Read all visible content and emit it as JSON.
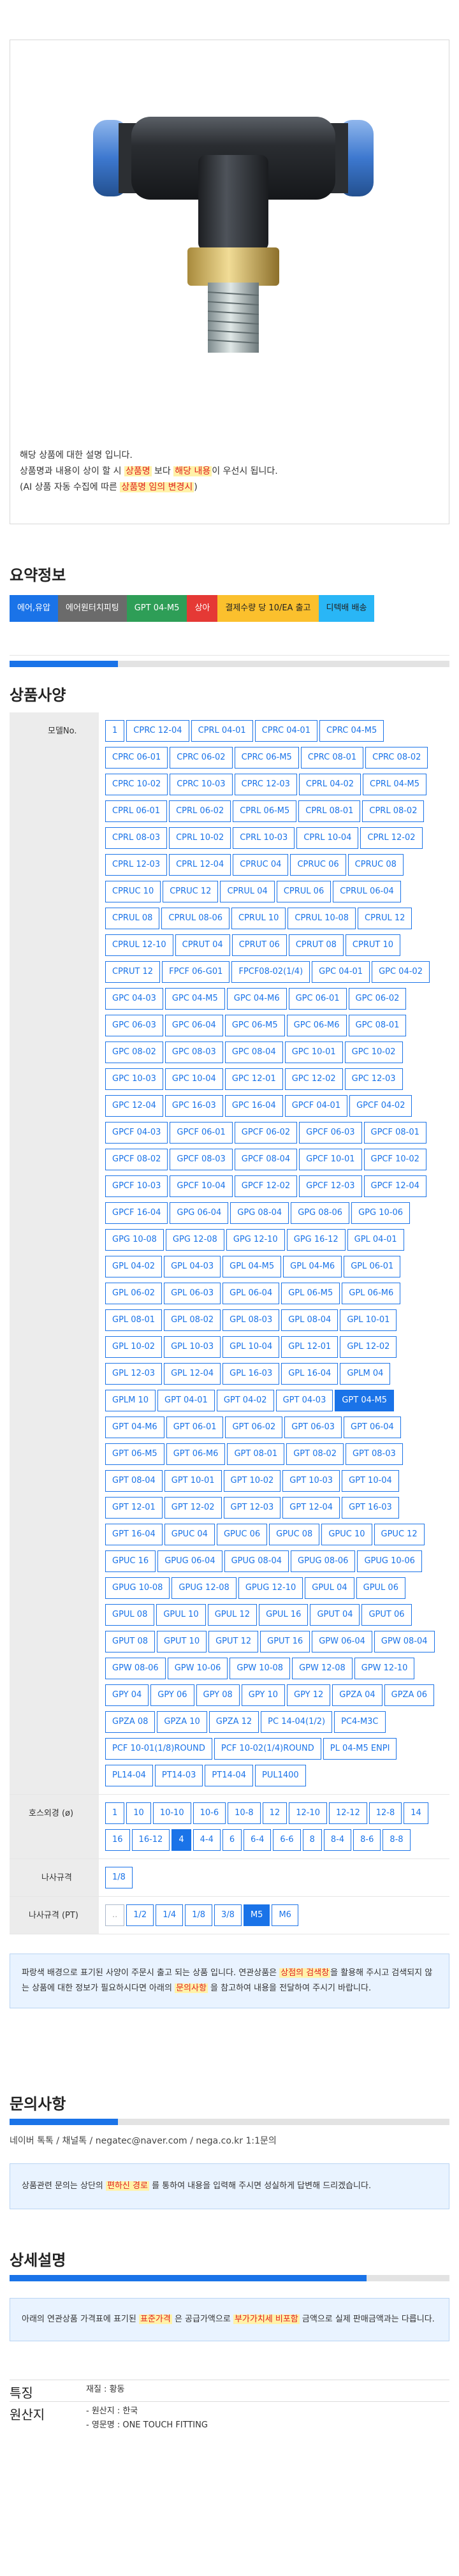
{
  "notice": {
    "line1": "해당 상품에 대한 설명 입니다.",
    "line2_a": "상품명과 내용이 상이 할 시 ",
    "line2_b": "상품명",
    "line2_c": " 보다 ",
    "line2_d": "해당 내용",
    "line2_e": "이 우선시 됩니다.",
    "line3_a": "(AI 상품 자동 수집에 따른 ",
    "line3_b": "상품명 임의 변경시",
    "line3_c": ")"
  },
  "summary": {
    "title": "요약정보",
    "tags": [
      {
        "label": "에어,유압",
        "color": "#1a73e8"
      },
      {
        "label": "에어원터치피팅",
        "color": "#6b6b6b"
      },
      {
        "label": "GPT 04-M5",
        "color": "#2e9e57"
      },
      {
        "label": "상아",
        "color": "#e53935"
      },
      {
        "label": "결제수량 당 10/EA 출고",
        "color": "#fbc02d",
        "text": "#222"
      },
      {
        "label": "디텍배 배송",
        "color": "#29b6f6",
        "text": "#222"
      }
    ]
  },
  "spec": {
    "title": "상품사양",
    "model_label": "모델No.",
    "models": [
      "1",
      "CPRC 12-04",
      "CPRL 04-01",
      "CPRC 04-01",
      "CPRC 04-M5",
      "CPRC 06-01",
      "CPRC 06-02",
      "CPRC 06-M5",
      "CPRC 08-01",
      "CPRC 08-02",
      "CPRC 10-02",
      "CPRC 10-03",
      "CPRC 12-03",
      "CPRL 04-02",
      "CPRL 04-M5",
      "CPRL 06-01",
      "CPRL 06-02",
      "CPRL 06-M5",
      "CPRL 08-01",
      "CPRL 08-02",
      "CPRL 08-03",
      "CPRL 10-02",
      "CPRL 10-03",
      "CPRL 10-04",
      "CPRL 12-02",
      "CPRL 12-03",
      "CPRL 12-04",
      "CPRUC 04",
      "CPRUC 06",
      "CPRUC 08",
      "CPRUC 10",
      "CPRUC 12",
      "CPRUL 04",
      "CPRUL 06",
      "CPRUL 06-04",
      "CPRUL 08",
      "CPRUL 08-06",
      "CPRUL 10",
      "CPRUL 10-08",
      "CPRUL 12",
      "CPRUL 12-10",
      "CPRUT 04",
      "CPRUT 06",
      "CPRUT 08",
      "CPRUT 10",
      "CPRUT 12",
      "FPCF 06-G01",
      "FPCF08-02(1/4)",
      "GPC 04-01",
      "GPC 04-02",
      "GPC 04-03",
      "GPC 04-M5",
      "GPC 04-M6",
      "GPC 06-01",
      "GPC 06-02",
      "GPC 06-03",
      "GPC 06-04",
      "GPC 06-M5",
      "GPC 06-M6",
      "GPC 08-01",
      "GPC 08-02",
      "GPC 08-03",
      "GPC 08-04",
      "GPC 10-01",
      "GPC 10-02",
      "GPC 10-03",
      "GPC 10-04",
      "GPC 12-01",
      "GPC 12-02",
      "GPC 12-03",
      "GPC 12-04",
      "GPC 16-03",
      "GPC 16-04",
      "GPCF 04-01",
      "GPCF 04-02",
      "GPCF 04-03",
      "GPCF 06-01",
      "GPCF 06-02",
      "GPCF 06-03",
      "GPCF 08-01",
      "GPCF 08-02",
      "GPCF 08-03",
      "GPCF 08-04",
      "GPCF 10-01",
      "GPCF 10-02",
      "GPCF 10-03",
      "GPCF 10-04",
      "GPCF 12-02",
      "GPCF 12-03",
      "GPCF 12-04",
      "GPCF 16-04",
      "GPG 06-04",
      "GPG 08-04",
      "GPG 08-06",
      "GPG 10-06",
      "GPG 10-08",
      "GPG 12-08",
      "GPG 12-10",
      "GPG 16-12",
      "GPL 04-01",
      "GPL 04-02",
      "GPL 04-03",
      "GPL 04-M5",
      "GPL 04-M6",
      "GPL 06-01",
      "GPL 06-02",
      "GPL 06-03",
      "GPL 06-04",
      "GPL 06-M5",
      "GPL 06-M6",
      "GPL 08-01",
      "GPL 08-02",
      "GPL 08-03",
      "GPL 08-04",
      "GPL 10-01",
      "GPL 10-02",
      "GPL 10-03",
      "GPL 10-04",
      "GPL 12-01",
      "GPL 12-02",
      "GPL 12-03",
      "GPL 12-04",
      "GPL 16-03",
      "GPL 16-04",
      "GPLM 04",
      "GPLM 10",
      "GPT 04-01",
      "GPT 04-02",
      "GPT 04-03",
      "GPT 04-M5",
      "GPT 04-M6",
      "GPT 06-01",
      "GPT 06-02",
      "GPT 06-03",
      "GPT 06-04",
      "GPT 06-M5",
      "GPT 06-M6",
      "GPT 08-01",
      "GPT 08-02",
      "GPT 08-03",
      "GPT 08-04",
      "GPT 10-01",
      "GPT 10-02",
      "GPT 10-03",
      "GPT 10-04",
      "GPT 12-01",
      "GPT 12-02",
      "GPT 12-03",
      "GPT 12-04",
      "GPT 16-03",
      "GPT 16-04",
      "GPUC 04",
      "GPUC 06",
      "GPUC 08",
      "GPUC 10",
      "GPUC 12",
      "GPUC 16",
      "GPUG 06-04",
      "GPUG 08-04",
      "GPUG 08-06",
      "GPUG 10-06",
      "GPUG 10-08",
      "GPUG 12-08",
      "GPUG 12-10",
      "GPUL 04",
      "GPUL 06",
      "GPUL 08",
      "GPUL 10",
      "GPUL 12",
      "GPUL 16",
      "GPUT 04",
      "GPUT 06",
      "GPUT 08",
      "GPUT 10",
      "GPUT 12",
      "GPUT 16",
      "GPW 06-04",
      "GPW 08-04",
      "GPW 08-06",
      "GPW 10-06",
      "GPW 10-08",
      "GPW 12-08",
      "GPW 12-10",
      "GPY 04",
      "GPY 06",
      "GPY 08",
      "GPY 10",
      "GPY 12",
      "GPZA 04",
      "GPZA 06",
      "GPZA 08",
      "GPZA 10",
      "GPZA 12",
      "PC 14-04(1/2)",
      "PC4-M3C",
      "PCF 10-01(1/8)ROUND",
      "PCF 10-02(1/4)ROUND",
      "PL 04-M5 ENPI",
      "PL14-04",
      "PT14-03",
      "PT14-04",
      "PUL1400"
    ],
    "model_selected": "GPT 04-M5",
    "hose_label": "호스외경 (ø)",
    "hose": [
      "1",
      "10",
      "10-10",
      "10-6",
      "10-8",
      "12",
      "12-10",
      "12-12",
      "12-8",
      "14",
      "16",
      "16-12",
      "4",
      "4-4",
      "6",
      "6-4",
      "6-6",
      "8",
      "8-4",
      "8-6",
      "8-8"
    ],
    "hose_selected": "4",
    "thread_label": "나사규격",
    "thread": [
      "1/8"
    ],
    "thread_pt_label": "나사규격 (PT)",
    "thread_pt": [
      "..",
      "1/2",
      "1/4",
      "1/8",
      "3/8",
      "M5",
      "M6"
    ],
    "thread_pt_selected": "M5",
    "alert_a": "파랑색 배경으로 표기된 사양이 주문시 출고 되는 상품 입니다. 연관상품은 ",
    "alert_b": "상점의 검색창",
    "alert_c": "을 활용해 주시고 검색되지 않는 상품에 대한 정보가 필요하시다면 아래의 ",
    "alert_d": "문의사항",
    "alert_e": " 을 참고하여 내용을 전달하여 주시기 바랍니다."
  },
  "inquiry": {
    "title": "문의사항",
    "links": "네이버 톡톡 / 채널톡 / negatec@naver.com / nega.co.kr 1:1문의",
    "text_a": "상품관련 문의는 상단의 ",
    "text_b": "편하신 경로",
    "text_c": " 를 통하여 내용을 입력해 주시면 성실하게 답변해 드리겠습니다."
  },
  "detail": {
    "title": "상세설명",
    "text_a": "아래의 연관상품 가격표에 표기된 ",
    "text_b": "표준가격",
    "text_c": " 은 공급가액으로 ",
    "text_d": "부가가치세 비포함",
    "text_e": " 금액으로 실제 판매금액과는 다릅니다."
  },
  "features": {
    "label1": "특징",
    "val1": "재질 : 황동",
    "label2": "원산지",
    "val2a": "- 원산지 : 한국",
    "val2b": "- 영문명 : ONE TOUCH FITTING"
  }
}
